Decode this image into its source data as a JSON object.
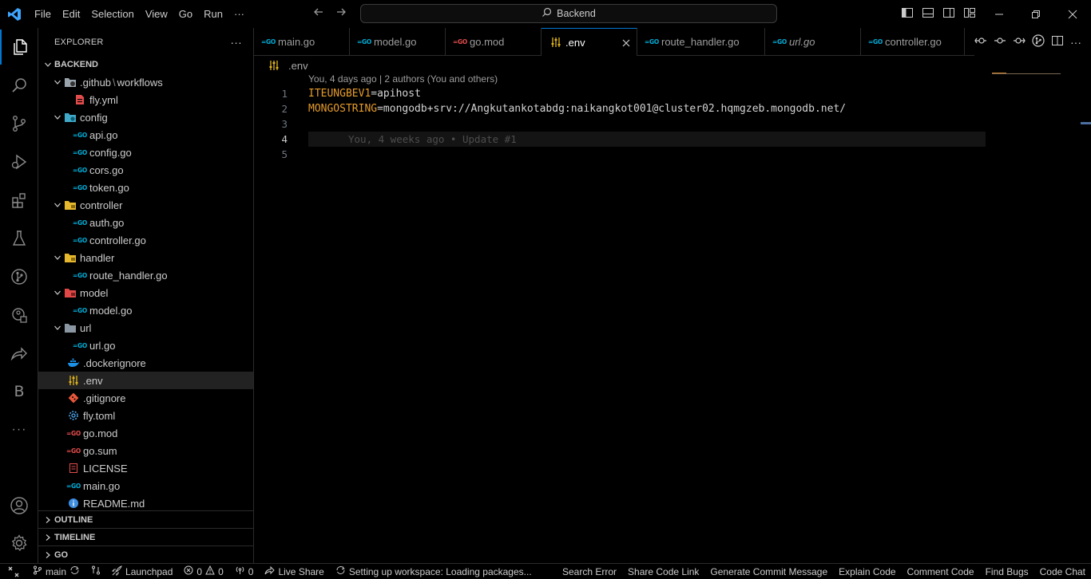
{
  "titlebar": {
    "menu": [
      "File",
      "Edit",
      "Selection",
      "View",
      "Go",
      "Run",
      "···"
    ],
    "search": "Backend"
  },
  "activitybar": {
    "items": [
      "files-icon",
      "search-icon",
      "source-control-icon",
      "run-debug-icon",
      "extensions-icon",
      "testing-icon",
      "git-graph-icon",
      "docker-icon",
      "live-share-icon"
    ],
    "letter_item": "B",
    "more": "···"
  },
  "sidebar": {
    "title": "EXPLORER",
    "more": "···",
    "root": "BACKEND",
    "tree": [
      {
        "name": ".github",
        "suffix": "workflows",
        "type": "folder"
      },
      {
        "name": "fly.yml",
        "type": "file"
      },
      {
        "name": "config",
        "type": "folder"
      },
      {
        "name": "api.go",
        "type": "file"
      },
      {
        "name": "config.go",
        "type": "file"
      },
      {
        "name": "cors.go",
        "type": "file"
      },
      {
        "name": "token.go",
        "type": "file"
      },
      {
        "name": "controller",
        "type": "folder"
      },
      {
        "name": "auth.go",
        "type": "file"
      },
      {
        "name": "controller.go",
        "type": "file"
      },
      {
        "name": "handler",
        "type": "folder"
      },
      {
        "name": "route_handler.go",
        "type": "file"
      },
      {
        "name": "model",
        "type": "folder"
      },
      {
        "name": "model.go",
        "type": "file"
      },
      {
        "name": "url",
        "type": "folder"
      },
      {
        "name": "url.go",
        "type": "file"
      },
      {
        "name": ".dockerignore",
        "type": "file"
      },
      {
        "name": ".env",
        "type": "file"
      },
      {
        "name": ".gitignore",
        "type": "file"
      },
      {
        "name": "fly.toml",
        "type": "file"
      },
      {
        "name": "go.mod",
        "type": "file"
      },
      {
        "name": "go.sum",
        "type": "file"
      },
      {
        "name": "LICENSE",
        "type": "file"
      },
      {
        "name": "main.go",
        "type": "file"
      },
      {
        "name": "README.md",
        "type": "file"
      }
    ],
    "sections": [
      "OUTLINE",
      "TIMELINE",
      "GO"
    ]
  },
  "tabs": [
    {
      "label": "main.go"
    },
    {
      "label": "model.go"
    },
    {
      "label": "go.mod"
    },
    {
      "label": ".env",
      "active": true
    },
    {
      "label": "route_handler.go"
    },
    {
      "label": "url.go"
    },
    {
      "label": "controller.go"
    }
  ],
  "editor": {
    "breadcrumb": ".env",
    "blame_header": "You, 4 days ago | 2 authors (You and others)",
    "line_numbers": [
      "1",
      "2",
      "3",
      "4",
      "5"
    ],
    "lines": [
      {
        "key": "ITEUNGBEV1",
        "eq": "=",
        "value": "apihost"
      },
      {
        "key": "MONGOSTRING",
        "eq": "=",
        "value": "mongodb+srv://Angkutankotabdg:naikangkot001@cluster02.hqmgzeb.mongodb.net/"
      },
      {
        "key": "",
        "eq": "",
        "value": ""
      },
      {
        "key": "",
        "eq": "",
        "value": "",
        "blame": "You, 4 weeks ago • Update #1"
      },
      {
        "key": "",
        "eq": "",
        "value": ""
      }
    ]
  },
  "statusbar": {
    "branch": "main",
    "launchpad": "Launchpad",
    "errors": "0",
    "warnings": "0",
    "ports": "0",
    "live_share": "Live Share",
    "workspace": "Setting up workspace: Loading packages...",
    "search_error": "Search Error",
    "share_code_link": "Share Code Link",
    "generate_commit": "Generate Commit Message",
    "explain_code": "Explain Code",
    "comment_code": "Comment Code",
    "find_bugs": "Find Bugs",
    "code_chat": "Code Chat"
  }
}
